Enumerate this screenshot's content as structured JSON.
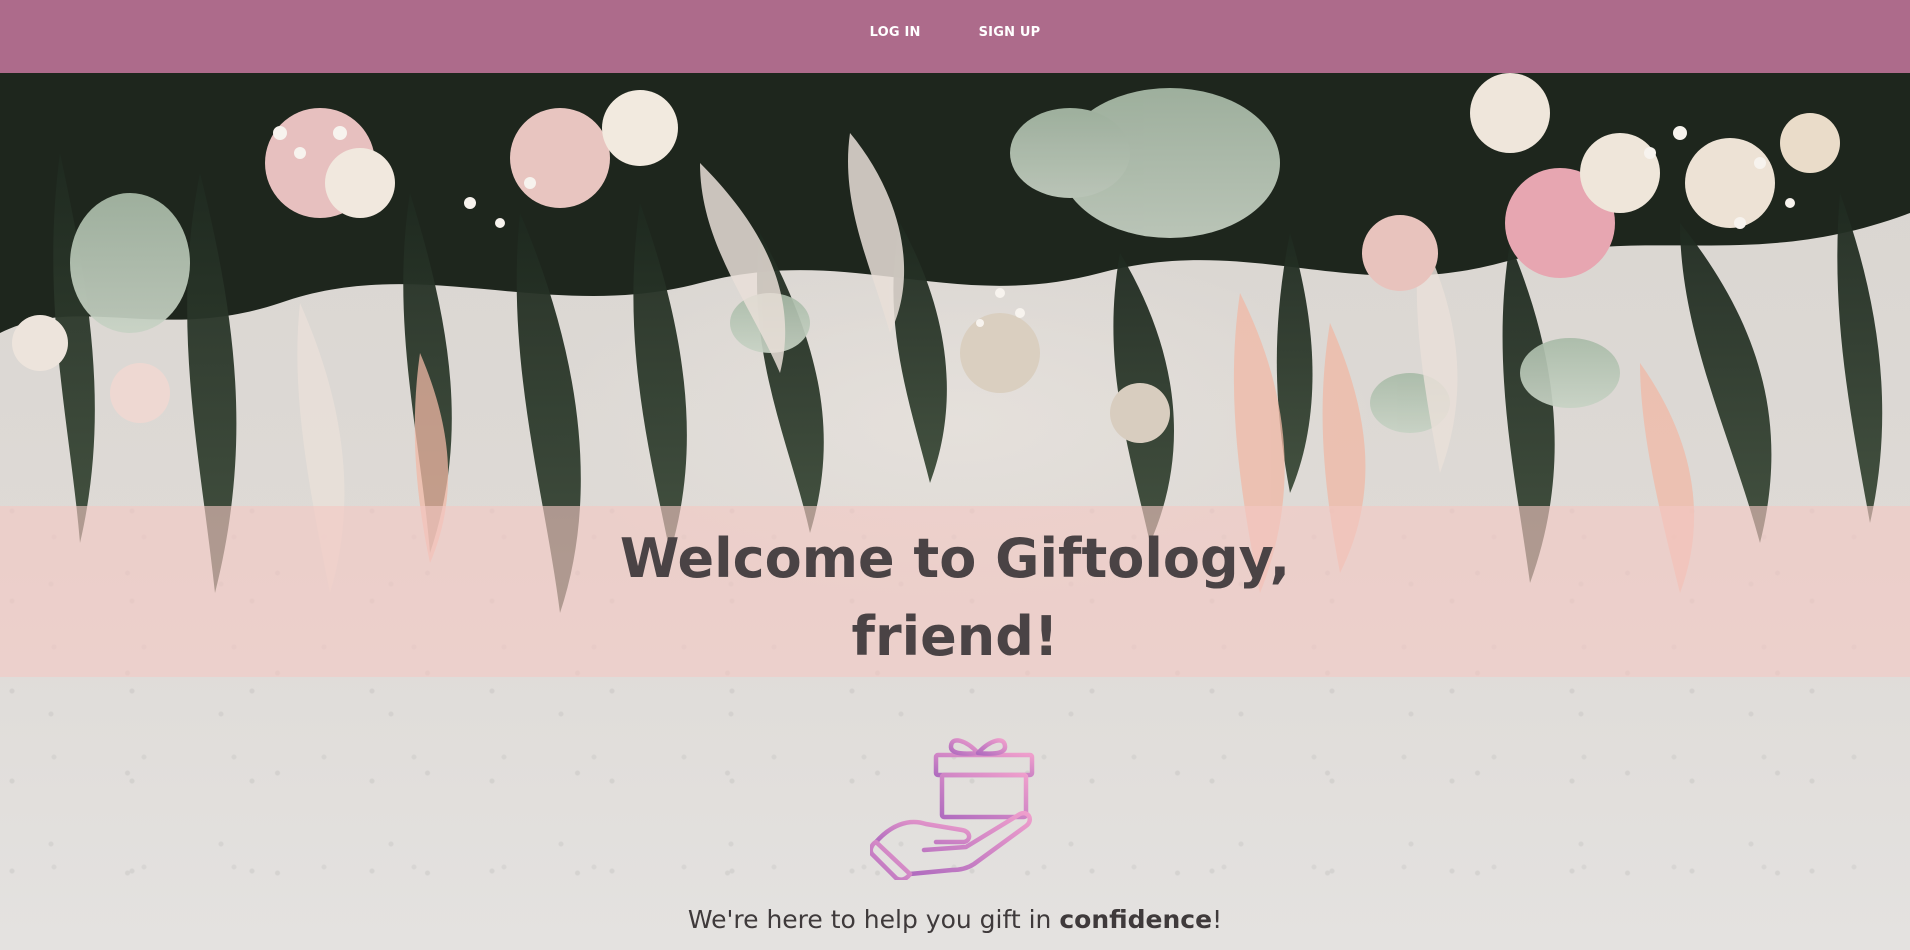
{
  "nav": {
    "login_label": "LOG IN",
    "signup_label": "SIGN UP"
  },
  "hero": {
    "welcome_line1": "Welcome to Giftology,",
    "welcome_line2": "friend!"
  },
  "tagline": {
    "prefix": "We're here to help you gift in ",
    "emphasis": "confidence",
    "suffix": "!"
  },
  "icons": {
    "gift": "gift-in-hand-icon"
  },
  "colors": {
    "navbar": "#ad6b8b",
    "band": "#f4c8c4",
    "title_text": "#4a4345",
    "icon_pink": "#e59ac6",
    "icon_purple": "#b06cbf"
  }
}
